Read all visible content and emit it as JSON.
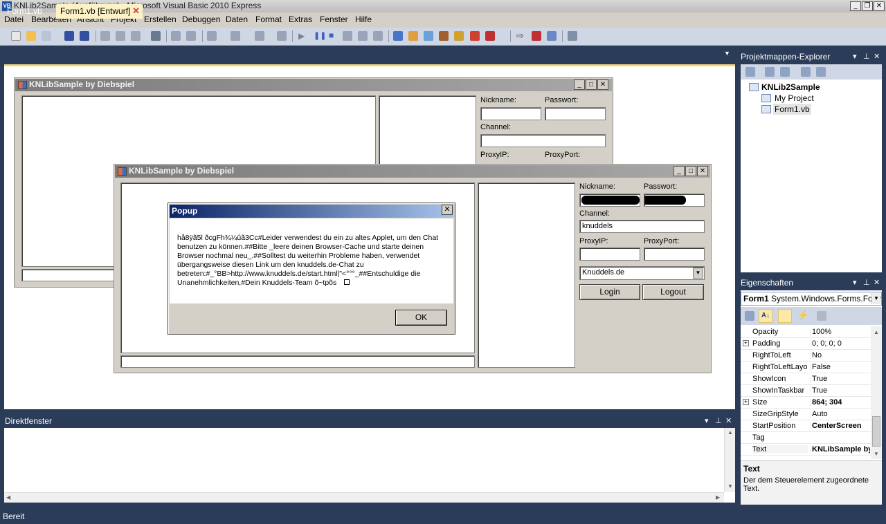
{
  "window": {
    "title": "KNLib2Sample (Ausführung) - Microsoft Visual Basic 2010 Express",
    "icon_label": "VB"
  },
  "menu": [
    "Datei",
    "Bearbeiten",
    "Ansicht",
    "Projekt",
    "Erstellen",
    "Debuggen",
    "Daten",
    "Format",
    "Extras",
    "Fenster",
    "Hilfe"
  ],
  "tabs": {
    "tab1": "Form1.vb",
    "tab2": "Form1.vb [Entwurf]"
  },
  "design_form": {
    "title": "KNLibSample by Diebspiel",
    "nickname_label": "Nickname:",
    "password_label": "Passwort:",
    "channel_label": "Channel:",
    "proxyip_label": "ProxyIP:",
    "proxyport_label": "ProxyPort:"
  },
  "run_form": {
    "title": "KNLibSample by Diebspiel",
    "nickname_label": "Nickname:",
    "password_label": "Passwort:",
    "channel_label": "Channel:",
    "channel_value": "knuddels",
    "proxyip_label": "ProxyIP:",
    "proxyport_label": "ProxyPort:",
    "server_value": "Knuddels.de",
    "login_button": "Login",
    "logout_button": "Logout"
  },
  "popup": {
    "title": "Popup",
    "message": "hå8ÿã5l ðcgFh¾¼ûã3Cc#Leider verwendest du ein zu altes Applet, um den Chat benutzen zu können.##Bitte _leere deinen Browser-Cache und starte deinen Browser nochmal neu_.##Solltest du weiterhin Probleme haben, verwendet übergangsweise diesen Link um den knuddels.de-Chat zu betreten:#_°BB>http://www.knuddels.de/start.html|\"<°°°_##Entschuldige die Unanehmlichkeiten,#Dein Knuddels-Team õ~tpõs",
    "ok_button": "OK"
  },
  "immediate": {
    "title": "Direktfenster"
  },
  "solution_explorer": {
    "title": "Projektmappen-Explorer",
    "project": "KNLib2Sample",
    "items": [
      "My Project",
      "Form1.vb"
    ]
  },
  "properties": {
    "title": "Eigenschaften",
    "object_name": "Form1",
    "object_type": "System.Windows.Forms.Form",
    "rows": [
      {
        "name": "Opacity",
        "value": "100%",
        "bold": false,
        "expander": false
      },
      {
        "name": "Padding",
        "value": "0; 0; 0; 0",
        "bold": false,
        "expander": true
      },
      {
        "name": "RightToLeft",
        "value": "No",
        "bold": false,
        "expander": false
      },
      {
        "name": "RightToLeftLayout",
        "value": "False",
        "bold": false,
        "expander": false
      },
      {
        "name": "ShowIcon",
        "value": "True",
        "bold": false,
        "expander": false
      },
      {
        "name": "ShowInTaskbar",
        "value": "True",
        "bold": false,
        "expander": false
      },
      {
        "name": "Size",
        "value": "864; 304",
        "bold": true,
        "expander": true
      },
      {
        "name": "SizeGripStyle",
        "value": "Auto",
        "bold": false,
        "expander": false
      },
      {
        "name": "StartPosition",
        "value": "CenterScreen",
        "bold": true,
        "expander": false
      },
      {
        "name": "Tag",
        "value": "",
        "bold": false,
        "expander": false
      },
      {
        "name": "Text",
        "value": "KNLibSample by Diebspiel",
        "bold": true,
        "expander": false
      }
    ],
    "description_title": "Text",
    "description_text": "Der dem Steuerelement zugeordnete Text."
  },
  "status": "Bereit"
}
